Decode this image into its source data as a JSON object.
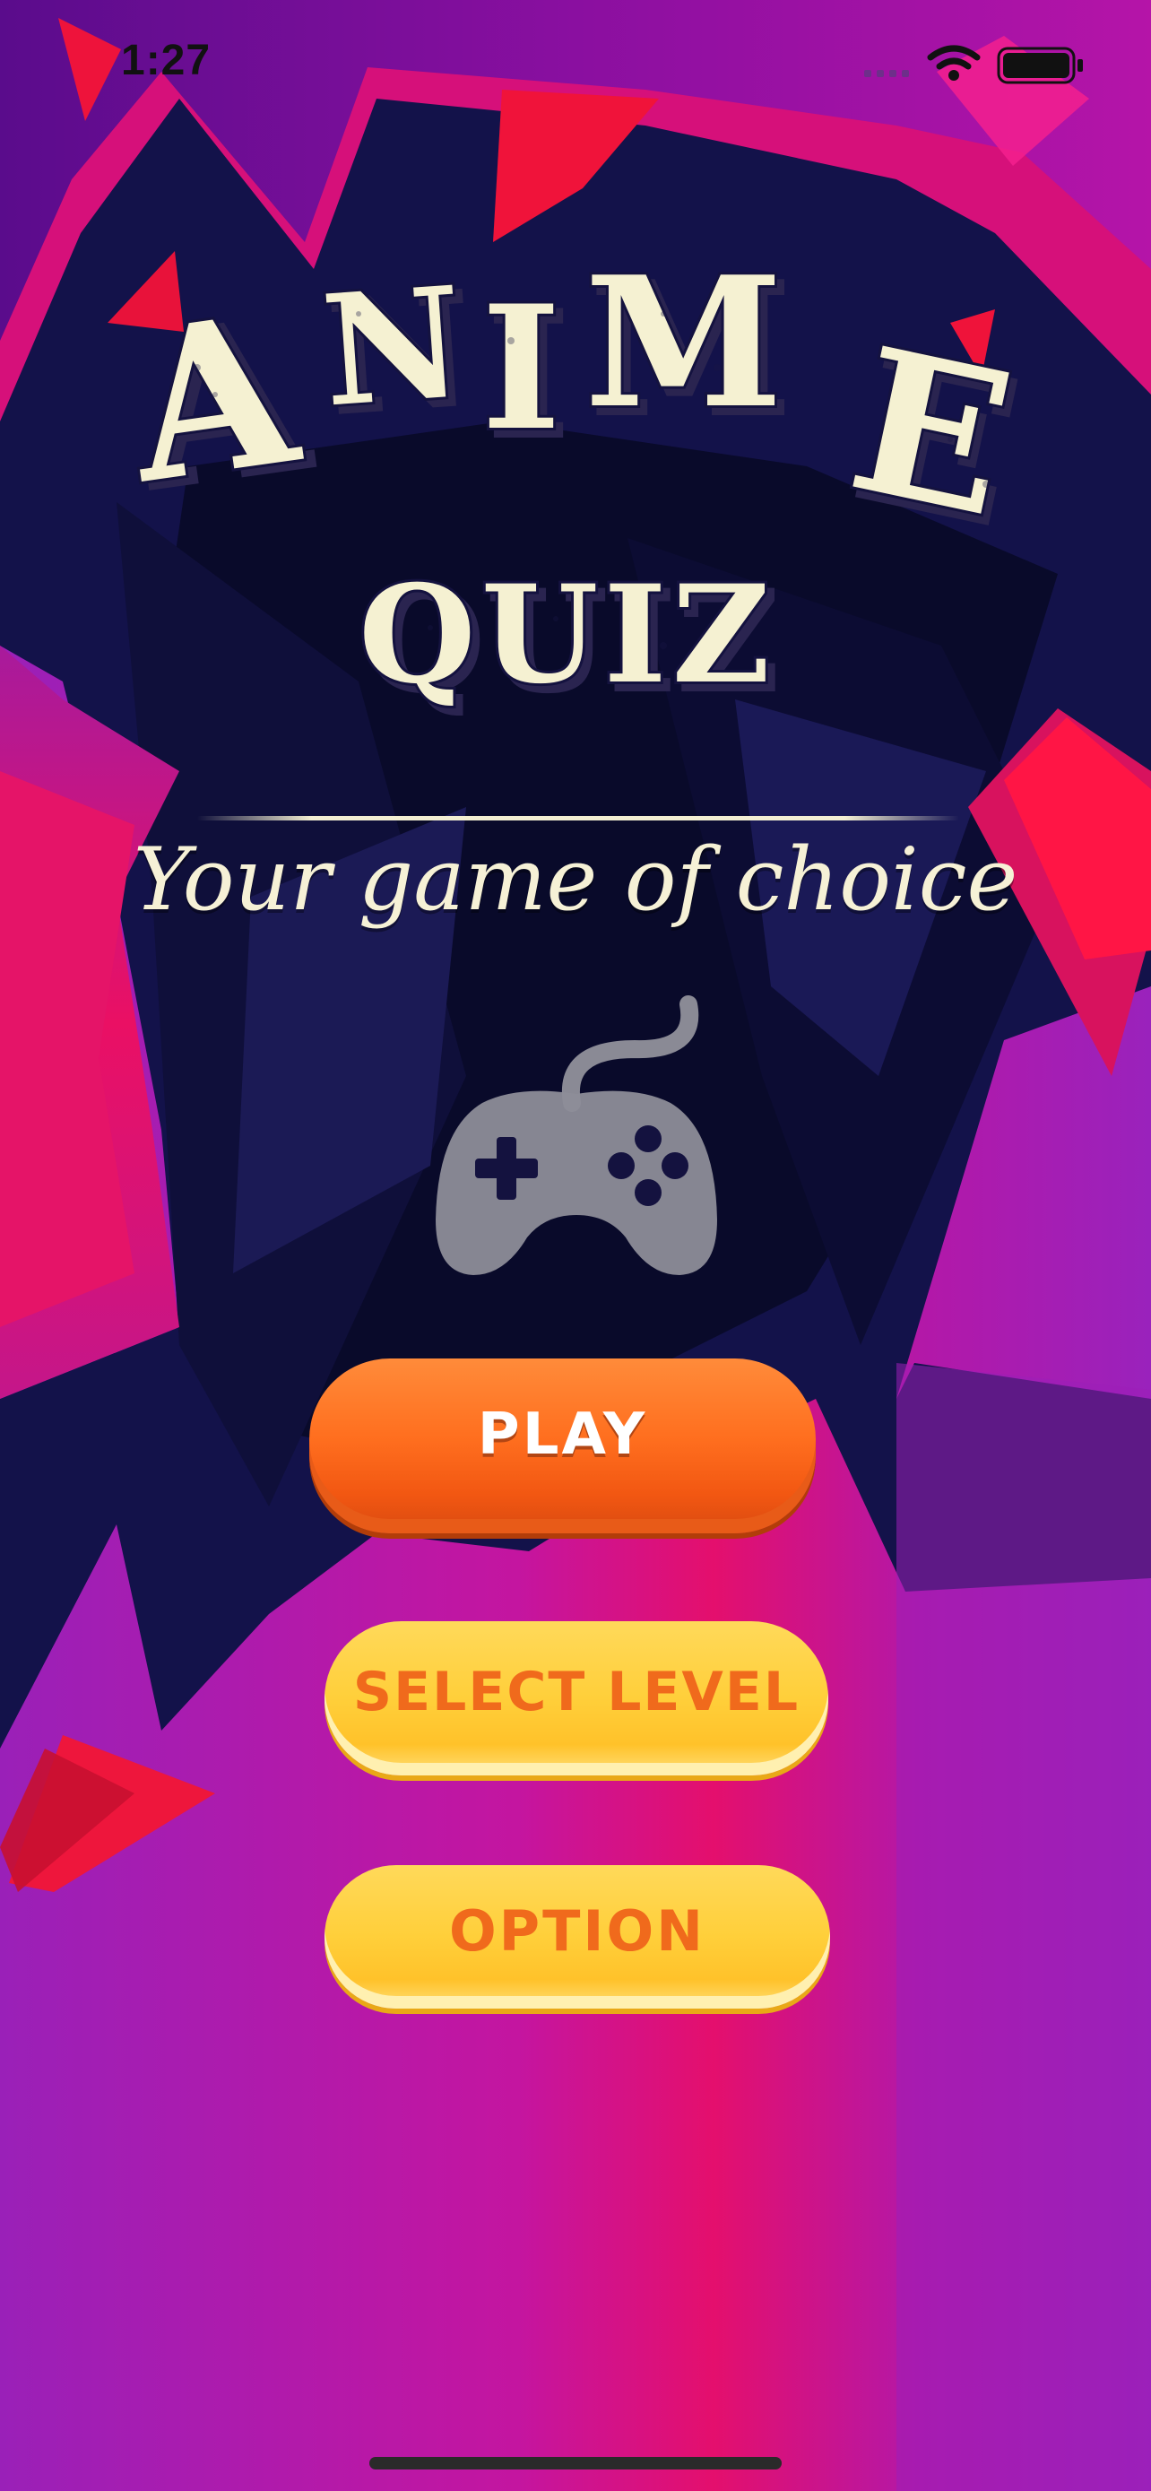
{
  "status_bar": {
    "time": "1:27",
    "icons": [
      "signal-icon",
      "wifi-icon",
      "battery-icon"
    ]
  },
  "title": {
    "line1": "ANIME",
    "line2": "QUIZ"
  },
  "tagline": "Your game of choice",
  "logo_icon": "gamepad-icon",
  "buttons": {
    "play": "PLAY",
    "select_level": "SELECT LEVEL",
    "option": "OPTION"
  },
  "colors": {
    "background_purple": "#9b22b8",
    "background_pink": "#e01071",
    "shard_navy": "#15134a",
    "accent_red": "#f0133a",
    "title_cream": "#f6f1d6",
    "play_orange": "#ff6f1f",
    "secondary_yellow": "#ffcf3a",
    "secondary_text_orange": "#f06a1c"
  }
}
